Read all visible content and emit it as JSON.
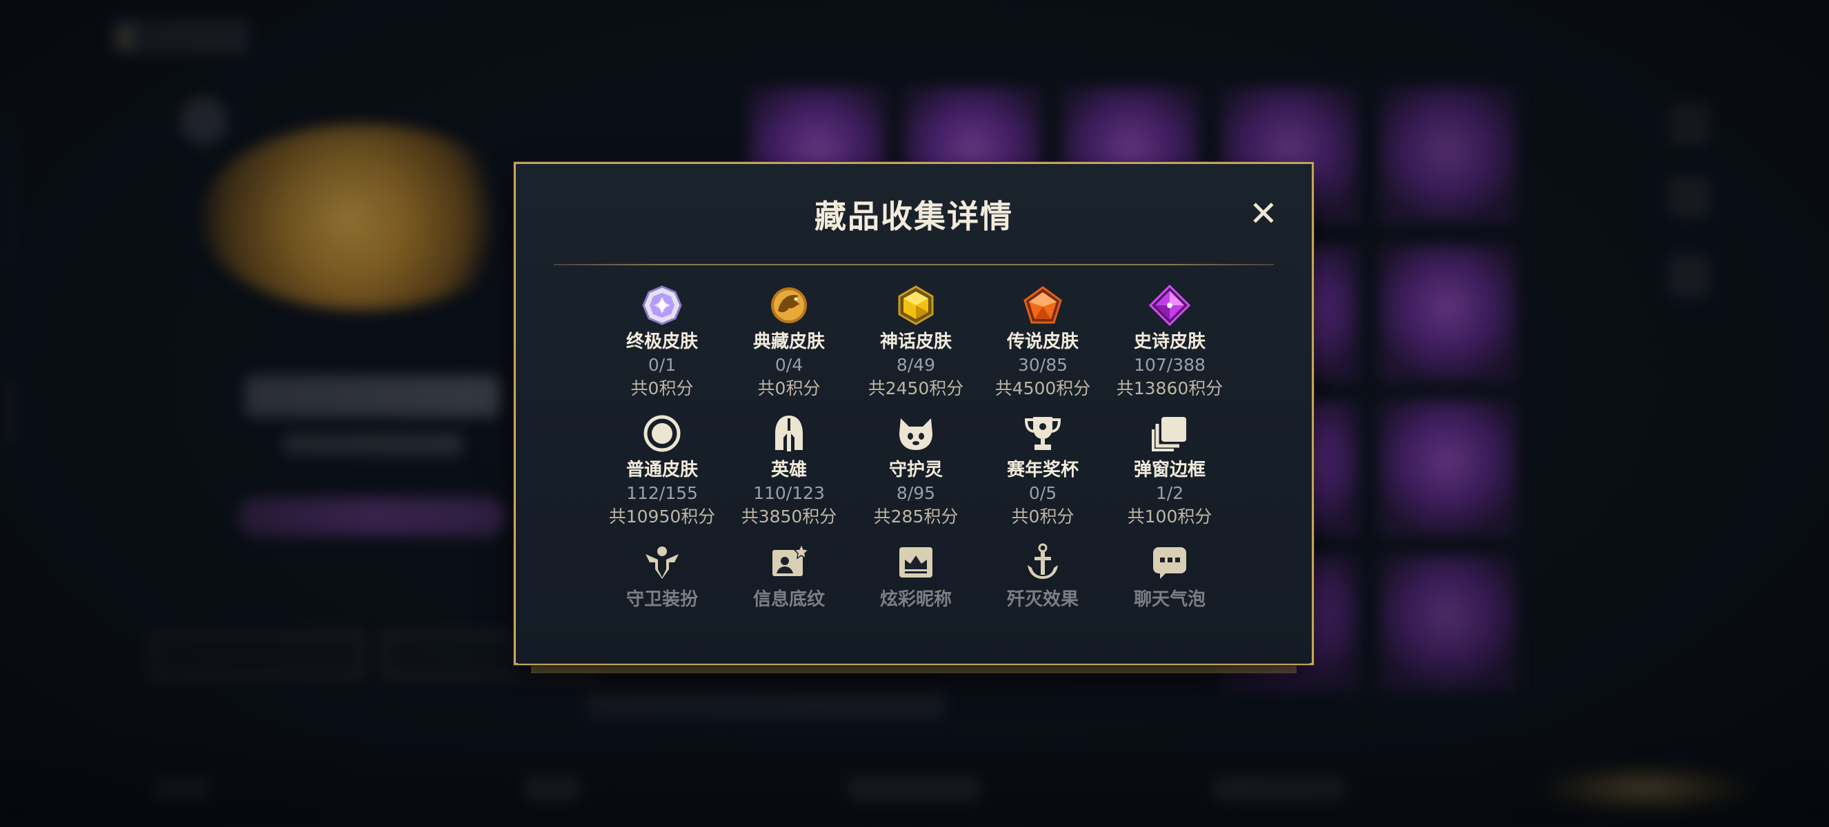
{
  "modal": {
    "title": "藏品收集详情",
    "close_label": "✕"
  },
  "items": [
    {
      "name": "终极皮肤",
      "count": "0/1",
      "points": "共0积分",
      "icon": "ultimate-skin-gem-icon",
      "color": "#b9a6ff"
    },
    {
      "name": "典藏皮肤",
      "count": "0/4",
      "points": "共0积分",
      "icon": "collection-skin-dragon-icon",
      "color": "#e0a83a"
    },
    {
      "name": "神话皮肤",
      "count": "8/49",
      "points": "共2450积分",
      "icon": "mythic-skin-gem-icon",
      "color": "#f0c20f"
    },
    {
      "name": "传说皮肤",
      "count": "30/85",
      "points": "共4500积分",
      "icon": "legendary-skin-gem-icon",
      "color": "#f06a1a"
    },
    {
      "name": "史诗皮肤",
      "count": "107/388",
      "points": "共13860积分",
      "icon": "epic-skin-gem-icon",
      "color": "#c33ee8"
    },
    {
      "name": "普通皮肤",
      "count": "112/155",
      "points": "共10950积分",
      "icon": "normal-skin-circle-icon",
      "color": "#e9e2cf"
    },
    {
      "name": "英雄",
      "count": "110/123",
      "points": "共3850积分",
      "icon": "hero-helmet-icon",
      "color": "#e9e2cf"
    },
    {
      "name": "守护灵",
      "count": "8/95",
      "points": "共285积分",
      "icon": "guardian-spirit-icon",
      "color": "#e9e2cf"
    },
    {
      "name": "赛年奖杯",
      "count": "0/5",
      "points": "共0积分",
      "icon": "season-trophy-icon",
      "color": "#e9e2cf"
    },
    {
      "name": "弹窗边框",
      "count": "1/2",
      "points": "共100积分",
      "icon": "popup-frame-icon",
      "color": "#e9e2cf"
    },
    {
      "name": "守卫装扮",
      "icon": "guard-outfit-icon",
      "color": "#d9cfb4"
    },
    {
      "name": "信息底纹",
      "icon": "info-background-icon",
      "color": "#d9cfb4"
    },
    {
      "name": "炫彩昵称",
      "icon": "colorful-nickname-icon",
      "color": "#d9cfb4"
    },
    {
      "name": "歼灭效果",
      "icon": "annihilation-effect-icon",
      "color": "#d9cfb4"
    },
    {
      "name": "聊天气泡",
      "icon": "chat-bubble-icon",
      "color": "#d9cfb4"
    }
  ]
}
